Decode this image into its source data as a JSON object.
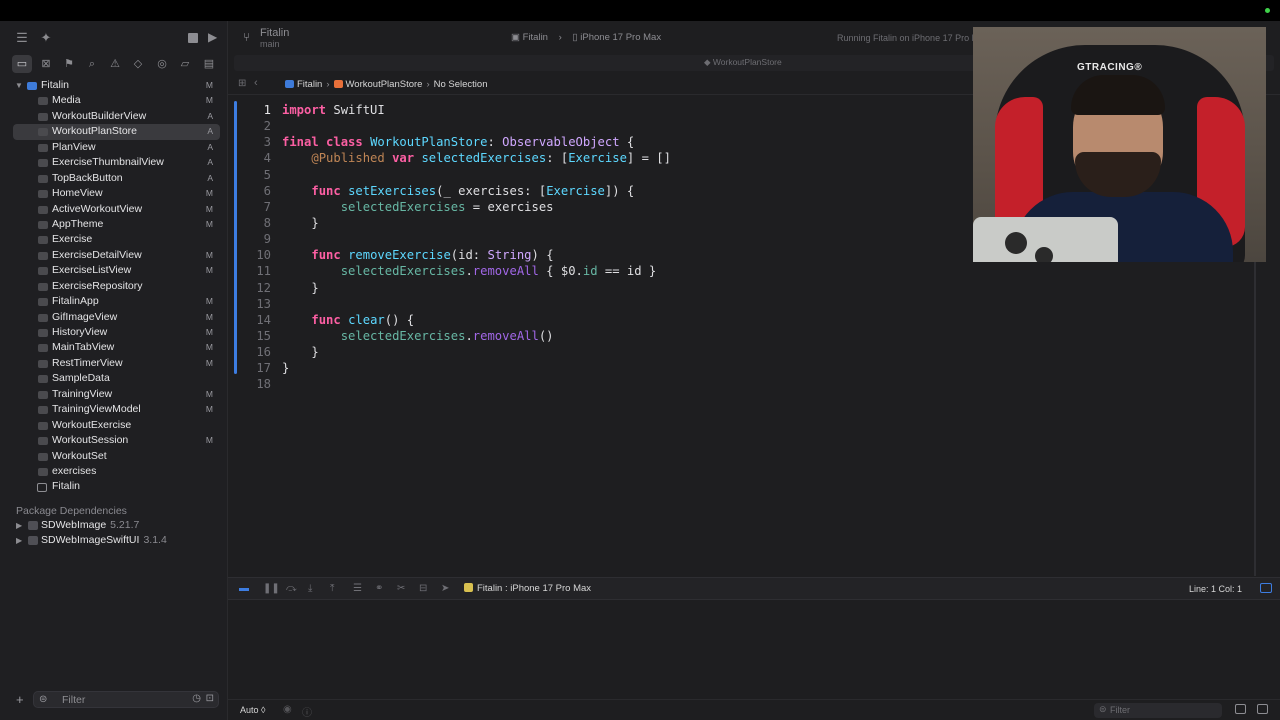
{
  "toolbar": {
    "project_name": "Fitalin",
    "branch": "main",
    "scheme": "Fitalin",
    "destination": "iPhone 17 Pro Max",
    "status": "Running Fitalin on iPhone 17 Pro M"
  },
  "tab": {
    "label": "WorkoutPlanStore"
  },
  "jumpbar": {
    "crumbs": [
      "Fitalin",
      "WorkoutPlanStore",
      "No Selection"
    ]
  },
  "navigator": {
    "root": "Fitalin",
    "items": [
      {
        "label": "Media",
        "status": "M"
      },
      {
        "label": "WorkoutBuilderView",
        "status": "A"
      },
      {
        "label": "WorkoutPlanStore",
        "status": "A",
        "selected": true
      },
      {
        "label": "PlanView",
        "status": "A"
      },
      {
        "label": "ExerciseThumbnailView",
        "status": "A"
      },
      {
        "label": "TopBackButton",
        "status": "A"
      },
      {
        "label": "HomeView",
        "status": "M"
      },
      {
        "label": "ActiveWorkoutView",
        "status": "M"
      },
      {
        "label": "AppTheme",
        "status": "M"
      },
      {
        "label": "Exercise",
        "status": ""
      },
      {
        "label": "ExerciseDetailView",
        "status": "M"
      },
      {
        "label": "ExerciseListView",
        "status": "M"
      },
      {
        "label": "ExerciseRepository",
        "status": ""
      },
      {
        "label": "FitalinApp",
        "status": "M"
      },
      {
        "label": "GifImageView",
        "status": "M"
      },
      {
        "label": "HistoryView",
        "status": "M"
      },
      {
        "label": "MainTabView",
        "status": "M"
      },
      {
        "label": "RestTimerView",
        "status": "M"
      },
      {
        "label": "SampleData",
        "status": ""
      },
      {
        "label": "TrainingView",
        "status": "M"
      },
      {
        "label": "TrainingViewModel",
        "status": "M"
      },
      {
        "label": "WorkoutExercise",
        "status": ""
      },
      {
        "label": "WorkoutSession",
        "status": "M"
      },
      {
        "label": "WorkoutSet",
        "status": ""
      },
      {
        "label": "exercises",
        "status": ""
      },
      {
        "label": "Fitalin",
        "status": ""
      }
    ],
    "package_header": "Package Dependencies",
    "packages": [
      {
        "name": "SDWebImage",
        "version": "5.21.7"
      },
      {
        "name": "SDWebImageSwiftUI",
        "version": "3.1.4"
      }
    ],
    "filter_placeholder": "Filter"
  },
  "editor": {
    "current_line": 1,
    "lines": [
      "1",
      "2",
      "3",
      "4",
      "5",
      "6",
      "7",
      "8",
      "9",
      "10",
      "11",
      "12",
      "13",
      "14",
      "15",
      "16",
      "17",
      "18"
    ]
  },
  "debugbar": {
    "target": "Fitalin : iPhone 17 Pro Max",
    "cursor": "Line: 1  Col: 1"
  },
  "bottombar": {
    "auto_label": "Auto ◊",
    "filter_placeholder": "Filter"
  },
  "webcam": {
    "brand_text": "GTRACING®"
  },
  "colors": {
    "accent": "#3d7de1",
    "keyword": "#fc5fa3",
    "type": "#5dd8ff",
    "method": "#a167e6"
  }
}
